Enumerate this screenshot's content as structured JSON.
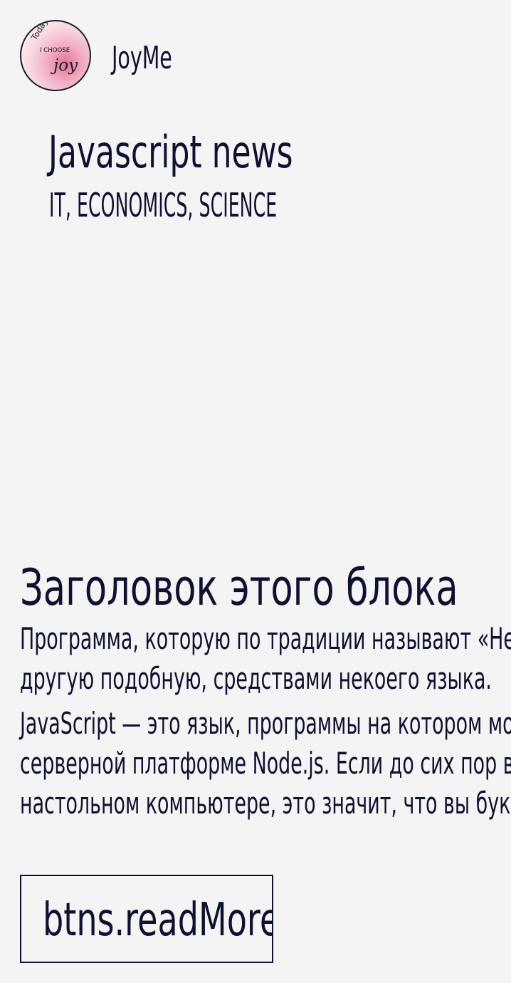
{
  "header": {
    "avatar_text": [
      "Today",
      "I CHOOSE",
      "joy"
    ],
    "brand": "JoyMe"
  },
  "hero": {
    "title": "Javascript news",
    "subtitle": "IT, ECONOMICS, SCIENCE"
  },
  "block": {
    "title": "Заголовок этого блока",
    "paragraphs": [
      "Программа, которую по традиции называют «Hello world», выводит строку текста. Она написана, как и любая\nдругую подобную, средствами некоего языка.",
      "JavaScript — это язык, программы на котором можно выполнять в разных средах: в браузере и на\nсерверной платформе Node.js. Если до сих пор вы не написали ни строчки кода на JS и читаете этот текст в браузере на\nнастольном компьютере, это значит, что вы буквально в считанных секундах от своей первой JavaScript-программы."
    ]
  },
  "buttons": {
    "read_more": "btns.readMore"
  },
  "colors": {
    "background": "#f4f4f4",
    "text": "#0f1130",
    "avatar_pink": "#e07595"
  }
}
